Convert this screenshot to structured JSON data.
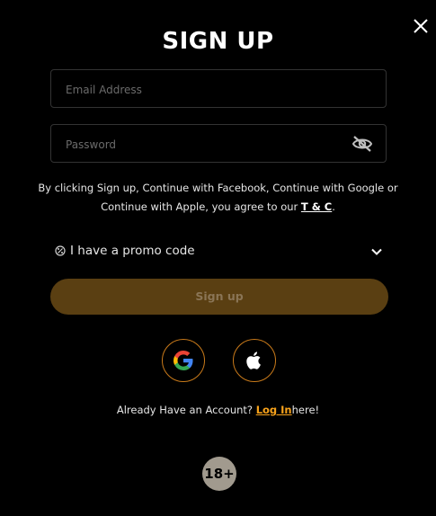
{
  "header": {
    "title": "SIGN UP"
  },
  "form": {
    "email_placeholder": "Email Address",
    "password_placeholder": "Password",
    "terms_text_1": "By clicking Sign up, Continue with Facebook, Continue with Google or Continue with Apple, you agree to our",
    "terms_link": "T & C",
    "terms_suffix": ".",
    "promo_label": "I have a promo code",
    "signup_label": "Sign up"
  },
  "social": {
    "google": "google-icon",
    "apple": "apple-icon"
  },
  "footer": {
    "login_prefix": "Already Have an Account?",
    "login_link": "Log In",
    "login_suffix": "here!",
    "age_badge": "18+"
  },
  "colors": {
    "background": "#000000",
    "accent": "#f7a21b",
    "button_disabled": "#5a3f12",
    "social_border": "#c97a1a"
  }
}
